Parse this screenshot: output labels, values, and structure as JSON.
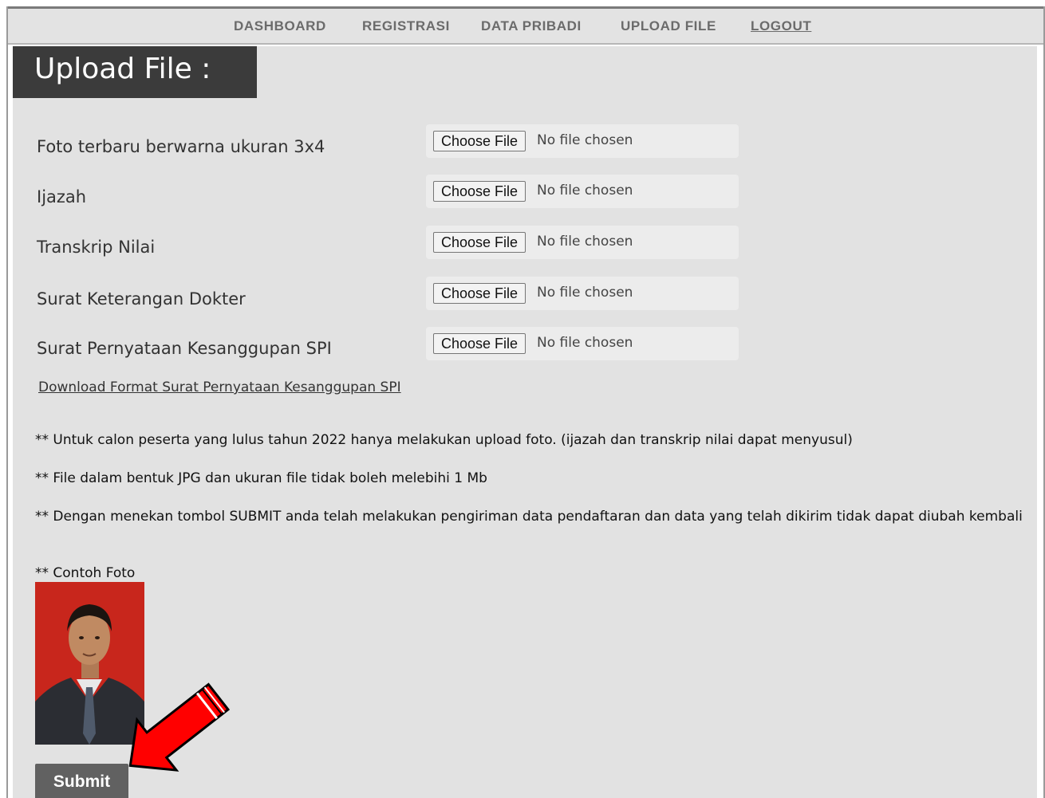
{
  "nav": {
    "items": [
      {
        "label": "DASHBOARD"
      },
      {
        "label": "REGISTRASI"
      },
      {
        "label": "DATA PRIBADI"
      },
      {
        "label": "UPLOAD FILE"
      },
      {
        "label": "LOGOUT"
      }
    ]
  },
  "page": {
    "title": "Upload File :"
  },
  "form": {
    "fields": [
      {
        "label": "Foto terbaru berwarna ukuran 3x4",
        "button": "Choose File",
        "status": "No file chosen"
      },
      {
        "label": "Ijazah",
        "button": "Choose File",
        "status": "No file chosen"
      },
      {
        "label": "Transkrip Nilai",
        "button": "Choose File",
        "status": "No file chosen"
      },
      {
        "label": "Surat Keterangan Dokter",
        "button": "Choose File",
        "status": "No file chosen"
      },
      {
        "label": "Surat Pernyataan Kesanggupan SPI",
        "button": "Choose File",
        "status": "No file chosen"
      }
    ],
    "download_link": "Download Format Surat Pernyataan Kesanggupan SPI",
    "notes": [
      "** Untuk calon peserta yang lulus tahun 2022 hanya melakukan upload foto. (ijazah dan transkrip nilai dapat menyusul)",
      "** File dalam bentuk JPG dan ukuran file tidak boleh melebihi 1 Mb",
      "** Dengan menekan tombol SUBMIT anda telah melakukan pengiriman data pendaftaran dan data yang telah dikirim tidak dapat diubah kembali",
      "** Contoh Foto"
    ],
    "submit_label": "Submit"
  },
  "colors": {
    "panel": "#e2e2e2",
    "title_bg": "#3b3b3b",
    "submit_bg": "#616161",
    "photo_bg": "#c8261c",
    "arrow": "#ff0000"
  },
  "icons": {
    "annotation_arrow": "red-arrow-icon"
  }
}
